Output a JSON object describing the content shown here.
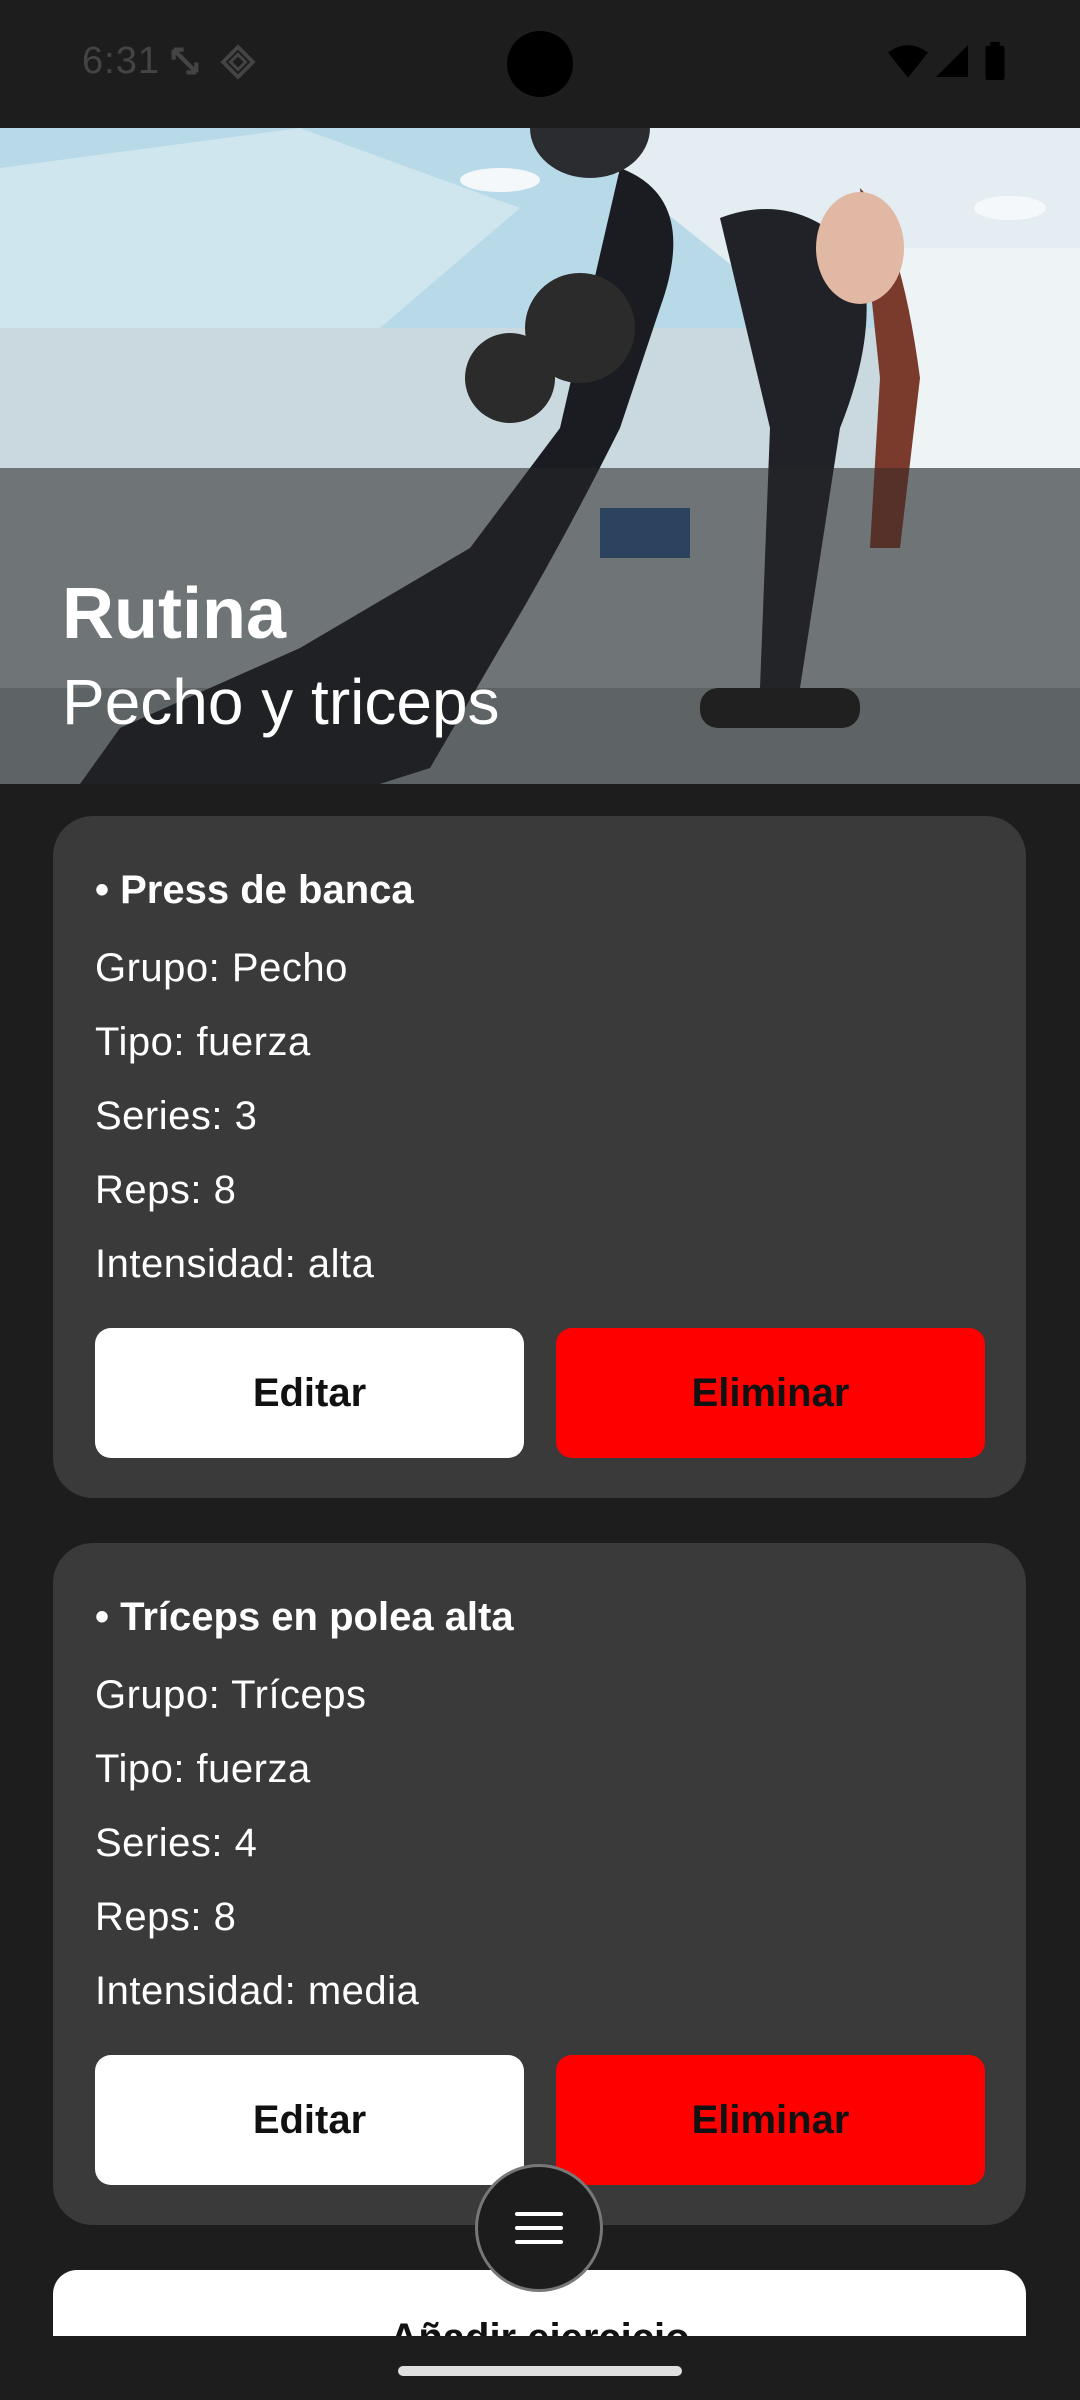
{
  "status": {
    "time": "6:31",
    "icons": [
      "screen-rotate-icon",
      "vpn-diamond-icon",
      "wifi-icon",
      "signal-icon",
      "battery-icon"
    ]
  },
  "header": {
    "label": "Rutina",
    "title": "Pecho y triceps"
  },
  "exercises": [
    {
      "title": "• Press de banca",
      "grupo": "Grupo: Pecho",
      "tipo": "Tipo: fuerza",
      "series": "Series: 3",
      "reps": "Reps: 8",
      "intensidad": "Intensidad: alta",
      "edit_label": "Editar",
      "delete_label": "Eliminar"
    },
    {
      "title": "• Tríceps en polea alta",
      "grupo": "Grupo: Tríceps",
      "tipo": "Tipo: fuerza",
      "series": "Series: 4",
      "reps": "Reps: 8",
      "intensidad": "Intensidad: media",
      "edit_label": "Editar",
      "delete_label": "Eliminar"
    }
  ],
  "add_button_label": "Añadir ejercicio",
  "fab_icon": "menu-icon",
  "colors": {
    "background": "#1d1d1d",
    "card": "#3a3a3a",
    "edit_button": "#ffffff",
    "delete_button": "#ff0000"
  }
}
